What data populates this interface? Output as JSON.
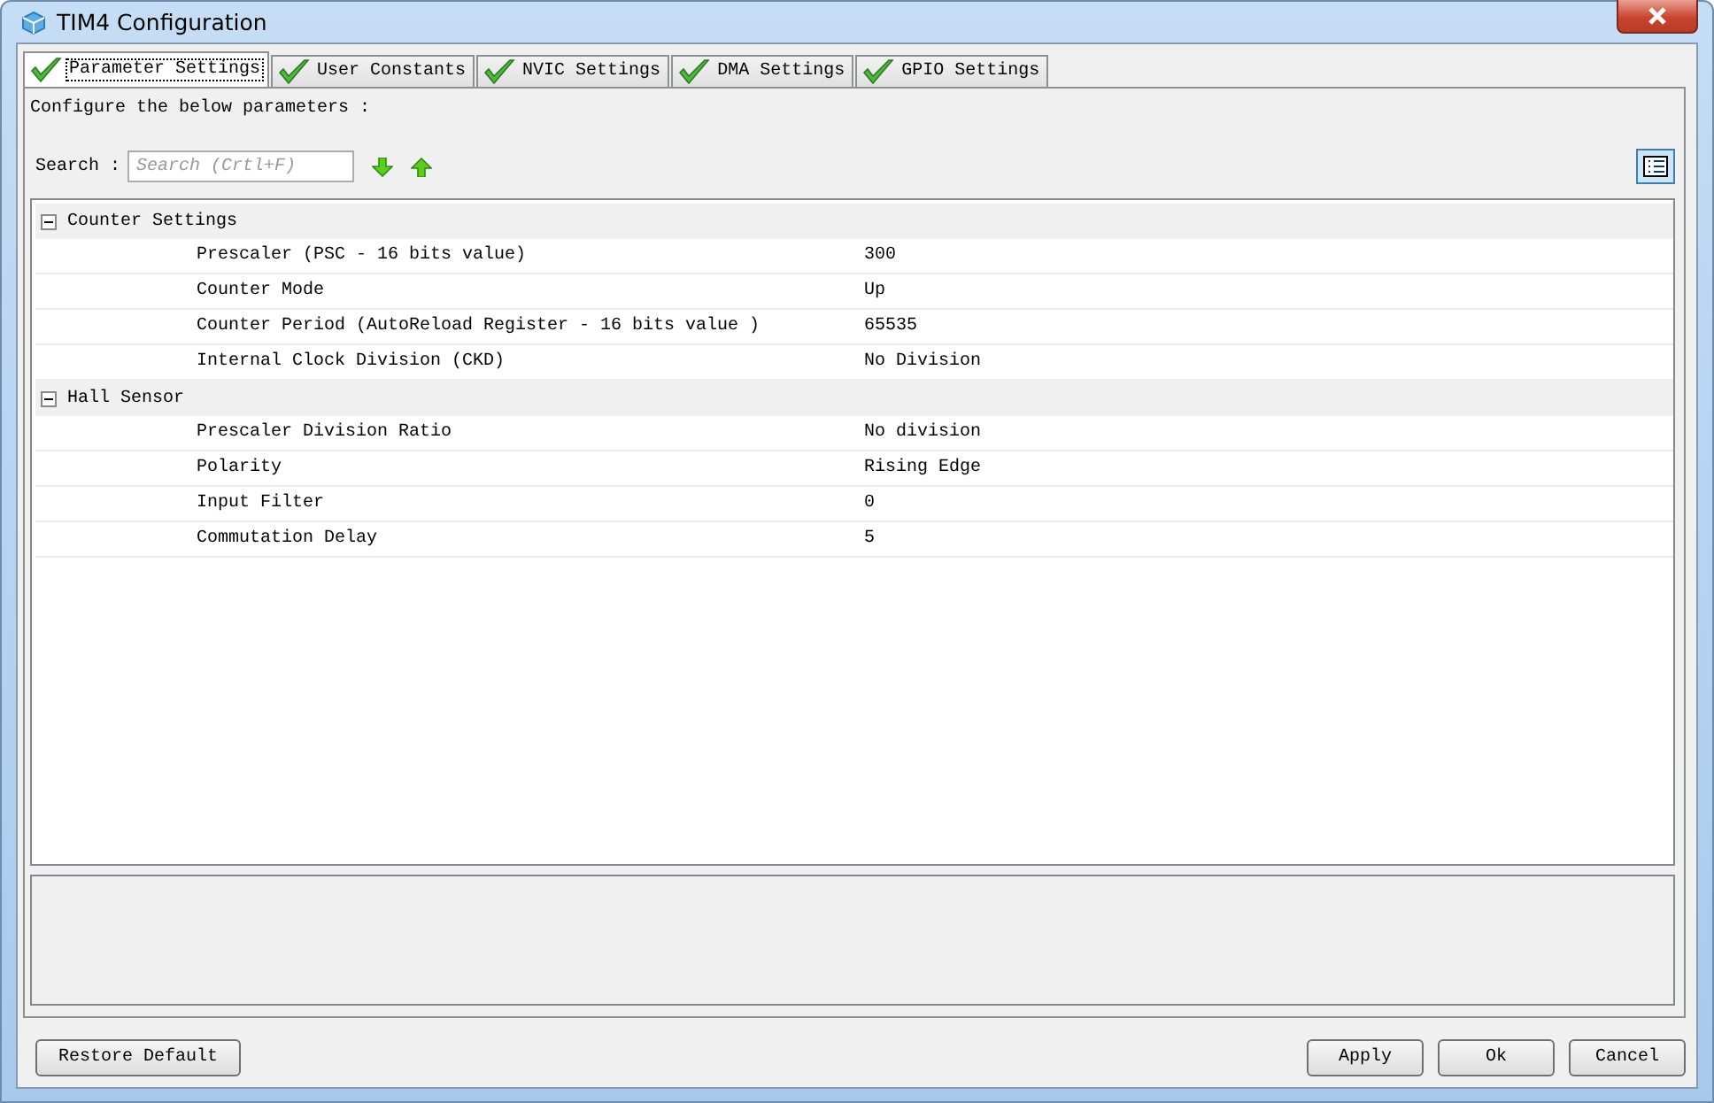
{
  "window": {
    "title": "TIM4 Configuration"
  },
  "tabs": [
    {
      "label": "Parameter Settings",
      "selected": true
    },
    {
      "label": "User Constants",
      "selected": false
    },
    {
      "label": "NVIC Settings",
      "selected": false
    },
    {
      "label": "DMA Settings",
      "selected": false
    },
    {
      "label": "GPIO Settings",
      "selected": false
    }
  ],
  "intro": "Configure the below parameters :",
  "search": {
    "label": "Search :",
    "placeholder": "Search (Crtl+F)"
  },
  "groups": [
    {
      "title": "Counter Settings",
      "expanded": true,
      "rows": [
        {
          "name": "Prescaler (PSC - 16 bits value)",
          "value": "300"
        },
        {
          "name": "Counter Mode",
          "value": "Up"
        },
        {
          "name": "Counter Period (AutoReload Register - 16 bits value )",
          "value": "65535"
        },
        {
          "name": "Internal Clock Division (CKD)",
          "value": "No Division"
        }
      ]
    },
    {
      "title": "Hall Sensor",
      "expanded": true,
      "rows": [
        {
          "name": "Prescaler Division Ratio",
          "value": "No division"
        },
        {
          "name": "Polarity",
          "value": "Rising Edge"
        },
        {
          "name": "Input Filter",
          "value": "0"
        },
        {
          "name": "Commutation Delay",
          "value": "5"
        }
      ]
    }
  ],
  "buttons_left": [
    "Restore Default"
  ],
  "buttons_right": [
    "Apply",
    "Ok",
    "Cancel"
  ]
}
